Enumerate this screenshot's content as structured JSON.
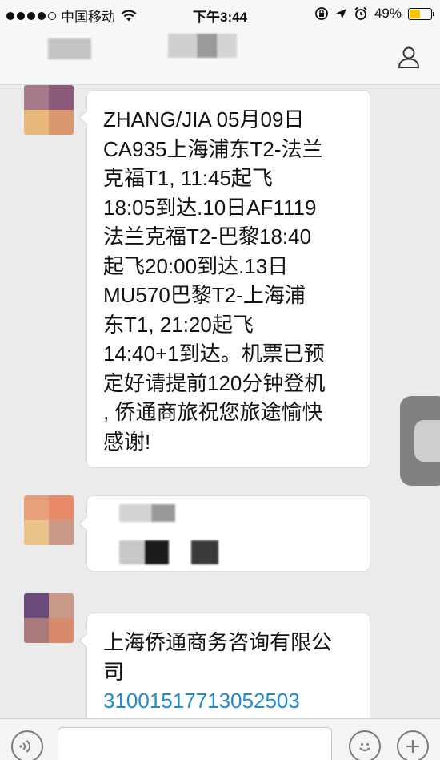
{
  "status_bar": {
    "carrier": "中国移动",
    "time": "下午3:44",
    "battery_percent": "49%",
    "battery_level": 0.49,
    "icons": [
      "signal-dots-icon",
      "wifi-icon",
      "rotation-lock-icon",
      "location-icon",
      "alarm-icon",
      "battery-icon"
    ]
  },
  "header": {
    "title_obscured": true,
    "profile_icon": "person-icon"
  },
  "messages": [
    {
      "type": "received",
      "text": "ZHANG/JIA 05月09日\nCA935上海浦东T2-法兰\n克福T1, 11:45起飞\n18:05到达.10日AF1119\n法兰克福T2-巴黎18:40\n起飞20:00到达.13日\nMU570巴黎T2-上海浦\n东T1, 21:20起飞\n14:40+1到达。机票已预\n定好请提前120分钟登机\n, 侨通商旅祝您旅途愉快\n感谢!"
    },
    {
      "type": "received",
      "obscured": true
    },
    {
      "type": "received",
      "text": "上海侨通商务咨询有限公\n司",
      "link": "31001517713052503"
    }
  ],
  "input_bar": {
    "voice_icon": "voice-icon",
    "emoji_icon": "emoji-icon",
    "plus_icon": "plus-icon",
    "value": "",
    "placeholder": ""
  },
  "colors": {
    "background": "#ebebeb",
    "bubble": "#ffffff",
    "link": "#1f8bd2",
    "battery": "#f5c400"
  }
}
